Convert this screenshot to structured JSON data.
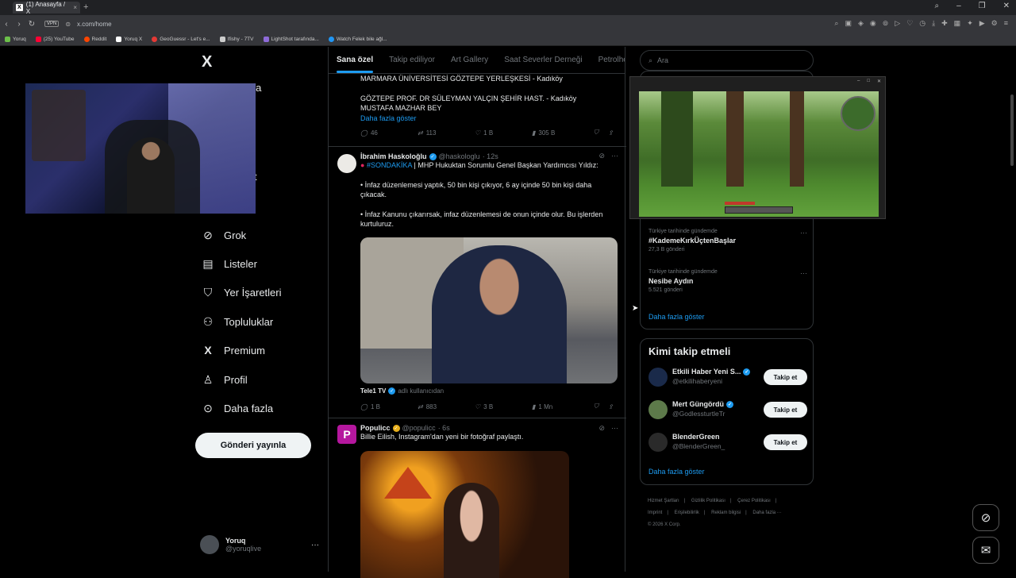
{
  "browser": {
    "tab_title": "(1) Anasayfa / X",
    "tab_favicon": "X",
    "url": "x.com/home",
    "vpn": "VPN",
    "bookmarks": [
      "Yoruq",
      "(25) YouTube",
      "Reddit",
      "Yoruq X",
      "GeoGuessr - Let's e...",
      "Ifishy - 7TV",
      "LightShot tarafında...",
      "Watch Felek bile ağl..."
    ]
  },
  "nav": {
    "logo": "X",
    "items": [
      {
        "label": "Grok",
        "icon": "grok-icon",
        "glyph": "⊘"
      },
      {
        "label": "Listeler",
        "icon": "lists-icon",
        "glyph": "▤"
      },
      {
        "label": "Yer İşaretleri",
        "icon": "bookmark-icon",
        "glyph": "🔖"
      },
      {
        "label": "Topluluklar",
        "icon": "communities-icon",
        "glyph": "👥"
      },
      {
        "label": "Premium",
        "icon": "premium-x-icon",
        "glyph": "X"
      },
      {
        "label": "Profil",
        "icon": "profile-icon",
        "glyph": "👤"
      },
      {
        "label": "Daha fazla",
        "icon": "more-circle-icon",
        "glyph": "⋯"
      }
    ],
    "partial_hidden": [
      "yfa",
      "nler",
      "t",
      "t"
    ],
    "post_button": "Gönderi yayınla",
    "user": {
      "name": "Yoruq",
      "handle": "@yoruqlive"
    }
  },
  "timeline": {
    "tabs": [
      "Sana özel",
      "Takip ediliyor",
      "Art Gallery",
      "Saat Severler Derneği",
      "Petrolhea"
    ],
    "tweet0": {
      "line1": "MARMARA ÜNİVERSİTESİ GÖZTEPE YERLEŞKESİ - Kadıköy",
      "line2": "GÖZTEPE PROF. DR SÜLEYMAN YALÇIN ŞEHİR HAST. - Kadıköy",
      "line3": "MUSTAFA MAZHAR BEY",
      "show_more": "Daha fazla göster",
      "replies": "46",
      "reposts": "113",
      "likes": "1 B",
      "views": "305 B"
    },
    "tweet1": {
      "name": "İbrahim Haskoloğlu",
      "handle": "@haskologlu",
      "time": "· 12s",
      "hashtag": "#SONDAKİKA",
      "text_head": " | MHP Hukuktan Sorumlu Genel Başkan Yardımcısı Yıldız:",
      "para1": "• İnfaz düzenlemesi yaptık, 50 bin kişi çıkıyor, 6 ay içinde 50 bin kişi daha çıkacak.",
      "para2": "• İnfaz Kanunu çıkarırsak, infaz düzenlemesi de onun içinde olur. Bu işlerden kurtuluruz.",
      "media_source": "Tele1 TV",
      "media_suffix": "adlı kullanıcıdan",
      "replies": "1 B",
      "reposts": "883",
      "likes": "3 B",
      "views": "1 Mn"
    },
    "tweet2": {
      "name": "Populicc",
      "handle": "@populicc",
      "time": "· 6s",
      "text": "Billie Eilish, Instagram'dan yeni bir fotoğraf paylaştı."
    }
  },
  "sidebar": {
    "search_placeholder": "Ara",
    "trends": [
      {
        "context": "Türkiye tarihinde gündemde",
        "title": "#KademeKırkÜçtenBaşlar",
        "count": "27,3 B gönderi"
      },
      {
        "context": "Türkiye tarihinde gündemde",
        "title": "Nesibe Aydın",
        "count": "5.521 gönderi"
      }
    ],
    "trends_show_more": "Daha fazla göster",
    "who_to_follow": {
      "title": "Kimi takip etmeli",
      "items": [
        {
          "name": "Etkili Haber Yeni S...",
          "handle": "@etkilihaberyeni",
          "button": "Takip et",
          "color": "#1a2a4a"
        },
        {
          "name": "Mert Güngördü",
          "handle": "@GodlessturtleTr",
          "button": "Takip et",
          "color": "#5d7a4a"
        },
        {
          "name": "BlenderGreen",
          "handle": "@BlenderGreen_",
          "button": "Takip et",
          "color": "#2a2a2a"
        }
      ],
      "show_more": "Daha fazla göster"
    },
    "footer": [
      "Hizmet Şartları",
      "|",
      "Gizlilik Politikası",
      "|",
      "Çerez Politikası",
      "|",
      "Imprint",
      "|",
      "Erişilebilirlik",
      "|",
      "Reklam bilgisi",
      "|",
      "Daha fazla ···",
      "© 2026 X Corp."
    ]
  },
  "colors": {
    "accent": "#1d9bf0",
    "background": "#000000",
    "muted": "#71767b"
  }
}
